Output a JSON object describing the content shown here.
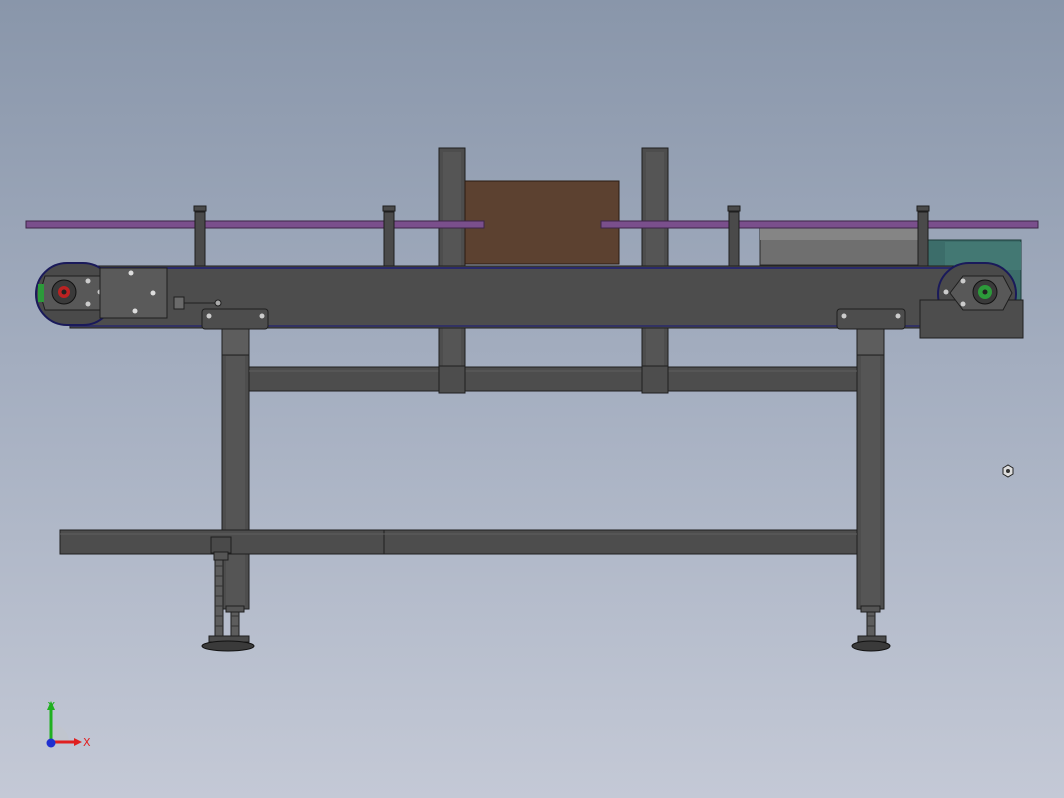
{
  "viewport": {
    "background_top": "#8996aa",
    "background_bottom": "#c4c9d6"
  },
  "model": {
    "frame_color": "#4d4d4d",
    "frame_dark": "#3a3a3a",
    "guide_rail_color": "#7a4f8c",
    "product_box_color": "#5c4130",
    "motor_color": "#3c6d6a",
    "motor_body_color": "#6e6e6e",
    "bearing_accent": "#2c9a3a"
  },
  "triad": {
    "x_label": "X",
    "y_label": "Y",
    "x_color": "#e02020",
    "y_color": "#20b020",
    "z_color": "#2030d0"
  }
}
